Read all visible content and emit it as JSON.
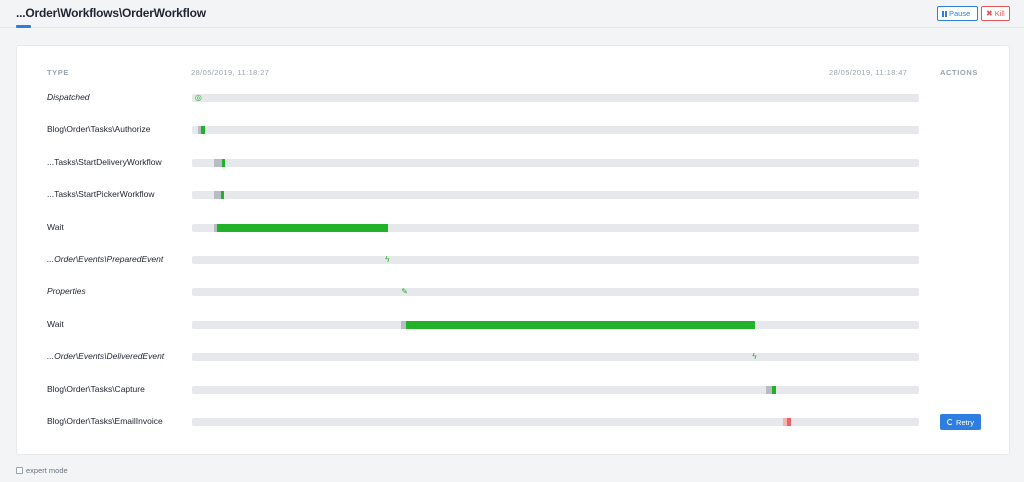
{
  "header": {
    "title": "...Order\\Workflows\\OrderWorkflow",
    "pause_label": "Pause",
    "kill_label": "Kill"
  },
  "table": {
    "col_type": "TYPE",
    "start_time": "28/05/2019, 11:18:27",
    "end_time": "28/05/2019, 11:18:47",
    "col_actions": "ACTIONS"
  },
  "rows": [
    {
      "label": "Dispatched",
      "italic": true,
      "marker": "dispatched-icon",
      "marker_glyph": "◎",
      "at": 0.008
    },
    {
      "label": "Blog\\Order\\Tasks\\Authorize",
      "italic": false,
      "segments": [
        {
          "kind": "wait",
          "from": 0.008,
          "to": 0.012
        },
        {
          "kind": "run",
          "from": 0.012,
          "to": 0.018
        }
      ]
    },
    {
      "label": "...Tasks\\StartDeliveryWorkflow",
      "italic": false,
      "segments": [
        {
          "kind": "wait",
          "from": 0.03,
          "to": 0.041
        },
        {
          "kind": "run",
          "from": 0.041,
          "to": 0.045
        }
      ]
    },
    {
      "label": "...Tasks\\StartPickerWorkflow",
      "italic": false,
      "segments": [
        {
          "kind": "wait",
          "from": 0.03,
          "to": 0.04
        },
        {
          "kind": "run",
          "from": 0.04,
          "to": 0.044
        }
      ]
    },
    {
      "label": "Wait",
      "italic": false,
      "segments": [
        {
          "kind": "wait",
          "from": 0.03,
          "to": 0.035
        },
        {
          "kind": "run",
          "from": 0.035,
          "to": 0.27
        }
      ]
    },
    {
      "label": "...Order\\Events\\PreparedEvent",
      "italic": true,
      "marker": "bolt-icon",
      "marker_glyph": "ϟ",
      "at": 0.27
    },
    {
      "label": "Properties",
      "italic": true,
      "marker": "pencil-icon",
      "marker_glyph": "✎",
      "at": 0.292
    },
    {
      "label": "Wait",
      "italic": false,
      "segments": [
        {
          "kind": "wait",
          "from": 0.288,
          "to": 0.294
        },
        {
          "kind": "run",
          "from": 0.294,
          "to": 0.775
        }
      ]
    },
    {
      "label": "...Order\\Events\\DeliveredEvent",
      "italic": true,
      "marker": "bolt-icon",
      "marker_glyph": "ϟ",
      "at": 0.775
    },
    {
      "label": "Blog\\Order\\Tasks\\Capture",
      "italic": false,
      "segments": [
        {
          "kind": "wait",
          "from": 0.79,
          "to": 0.798
        },
        {
          "kind": "run",
          "from": 0.798,
          "to": 0.803
        }
      ]
    },
    {
      "label": "Blog\\Order\\Tasks\\EmailInvoice",
      "italic": false,
      "action": "Retry",
      "segments": [
        {
          "kind": "fail-light",
          "from": 0.813,
          "to": 0.819
        },
        {
          "kind": "fail",
          "from": 0.819,
          "to": 0.824
        }
      ]
    }
  ],
  "footer": {
    "expert_mode_label": "expert mode"
  },
  "colors": {
    "accent": "#2e7de0",
    "success": "#22b22a",
    "danger": "#e25555",
    "track": "#e6e8eb"
  }
}
